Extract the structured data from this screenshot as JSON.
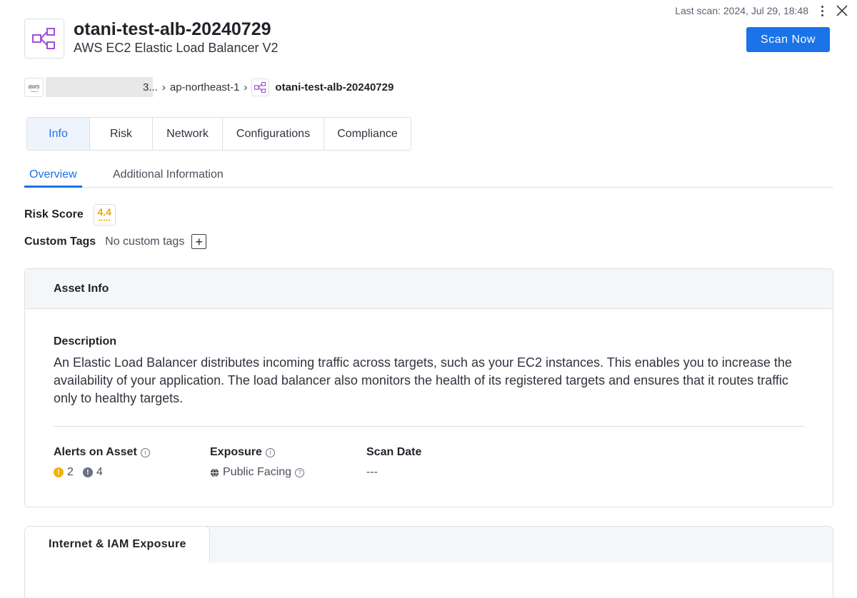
{
  "header": {
    "last_scan": "Last scan: 2024, Jul 29, 18:48",
    "scan_button": "Scan Now",
    "title": "otani-test-alb-20240729",
    "subtitle": "AWS EC2 Elastic Load Balancer V2"
  },
  "breadcrumb": {
    "aws_label": "aws",
    "account_truncated": "3...",
    "region": "ap-northeast-1",
    "current": "otani-test-alb-20240729"
  },
  "tabs": [
    {
      "label": "Info"
    },
    {
      "label": "Risk"
    },
    {
      "label": "Network"
    },
    {
      "label": "Configurations"
    },
    {
      "label": "Compliance"
    }
  ],
  "subtabs": [
    {
      "label": "Overview"
    },
    {
      "label": "Additional Information"
    }
  ],
  "risk": {
    "label": "Risk Score",
    "value": "4.4"
  },
  "tags": {
    "label": "Custom Tags",
    "empty_text": "No custom tags",
    "add_symbol": "+"
  },
  "asset_info": {
    "title": "Asset Info",
    "description_title": "Description",
    "description": "An Elastic Load Balancer distributes incoming traffic across targets, such as your EC2 instances. This enables you to increase the availability of your application. The load balancer also monitors the health of its registered targets and ensures that it routes traffic only to healthy targets.",
    "alerts_title": "Alerts on Asset",
    "alerts_warning": "2",
    "alerts_info": "4",
    "exposure_title": "Exposure",
    "exposure_value": "Public Facing",
    "scan_date_title": "Scan Date",
    "scan_date_value": "---"
  },
  "exposure_card": {
    "tab_label": "Internet & IAM Exposure"
  },
  "colors": {
    "accent": "#1a73e8",
    "asset_icon": "#a24fd6",
    "warning": "#f2b400",
    "risk": "#f2a600"
  }
}
